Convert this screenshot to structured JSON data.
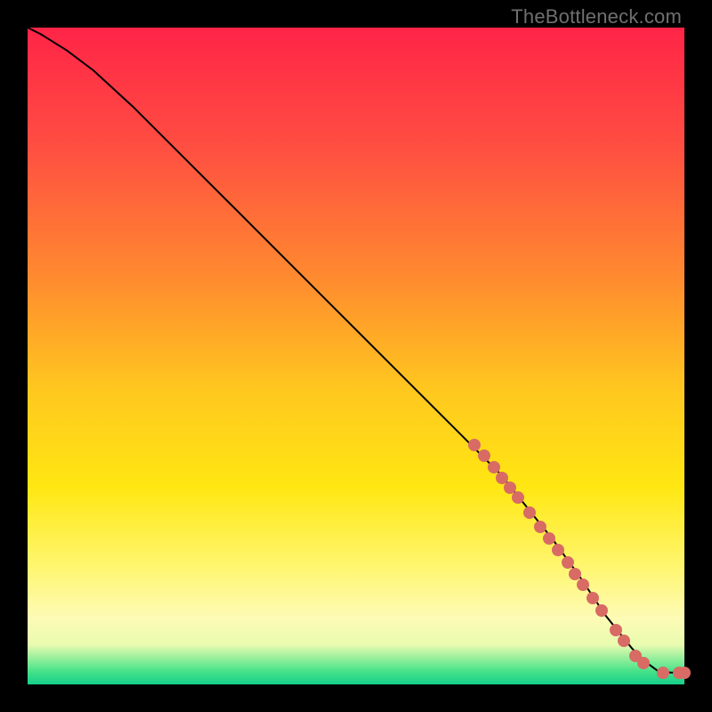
{
  "watermark": "TheBottleneck.com",
  "colors": {
    "marker": "#d86b64",
    "curve": "#000000",
    "frame_bg": "#000000"
  },
  "chart_data": {
    "type": "line",
    "title": "",
    "xlabel": "",
    "ylabel": "",
    "xlim": [
      0,
      100
    ],
    "ylim": [
      0,
      100
    ],
    "grid": false,
    "legend": false,
    "curve": {
      "comment": "decreasing curve from top-left to bottom-right; no axis ticks visible in image, values in percent of plot area",
      "x": [
        0,
        2,
        6,
        10,
        16,
        24,
        32,
        40,
        48,
        56,
        64,
        68,
        72,
        76,
        80,
        84,
        88,
        90,
        92,
        94,
        96,
        98,
        100
      ],
      "y": [
        100,
        99,
        96.5,
        93.5,
        88,
        80,
        72,
        64,
        56,
        48,
        40,
        36,
        32,
        27,
        22,
        16.5,
        10.5,
        8,
        5.5,
        3.5,
        2,
        1.8,
        1.8
      ]
    },
    "markers": {
      "comment": "salmon dots clustered on lower-right segment of curve; coordinates in percent of plot area",
      "points": [
        {
          "x": 68.0,
          "y": 36.5
        },
        {
          "x": 69.5,
          "y": 34.8
        },
        {
          "x": 71.0,
          "y": 33.0
        },
        {
          "x": 72.2,
          "y": 31.5
        },
        {
          "x": 73.4,
          "y": 30.0
        },
        {
          "x": 74.6,
          "y": 28.5
        },
        {
          "x": 76.4,
          "y": 26.2
        },
        {
          "x": 78.0,
          "y": 24.0
        },
        {
          "x": 79.4,
          "y": 22.2
        },
        {
          "x": 80.8,
          "y": 20.4
        },
        {
          "x": 82.2,
          "y": 18.5
        },
        {
          "x": 83.4,
          "y": 16.8
        },
        {
          "x": 84.6,
          "y": 15.2
        },
        {
          "x": 86.0,
          "y": 13.2
        },
        {
          "x": 87.4,
          "y": 11.2
        },
        {
          "x": 89.6,
          "y": 8.2
        },
        {
          "x": 90.8,
          "y": 6.6
        },
        {
          "x": 92.6,
          "y": 4.4
        },
        {
          "x": 93.8,
          "y": 3.2
        },
        {
          "x": 96.8,
          "y": 1.8
        },
        {
          "x": 99.2,
          "y": 1.8
        },
        {
          "x": 100.0,
          "y": 1.8
        }
      ]
    }
  }
}
